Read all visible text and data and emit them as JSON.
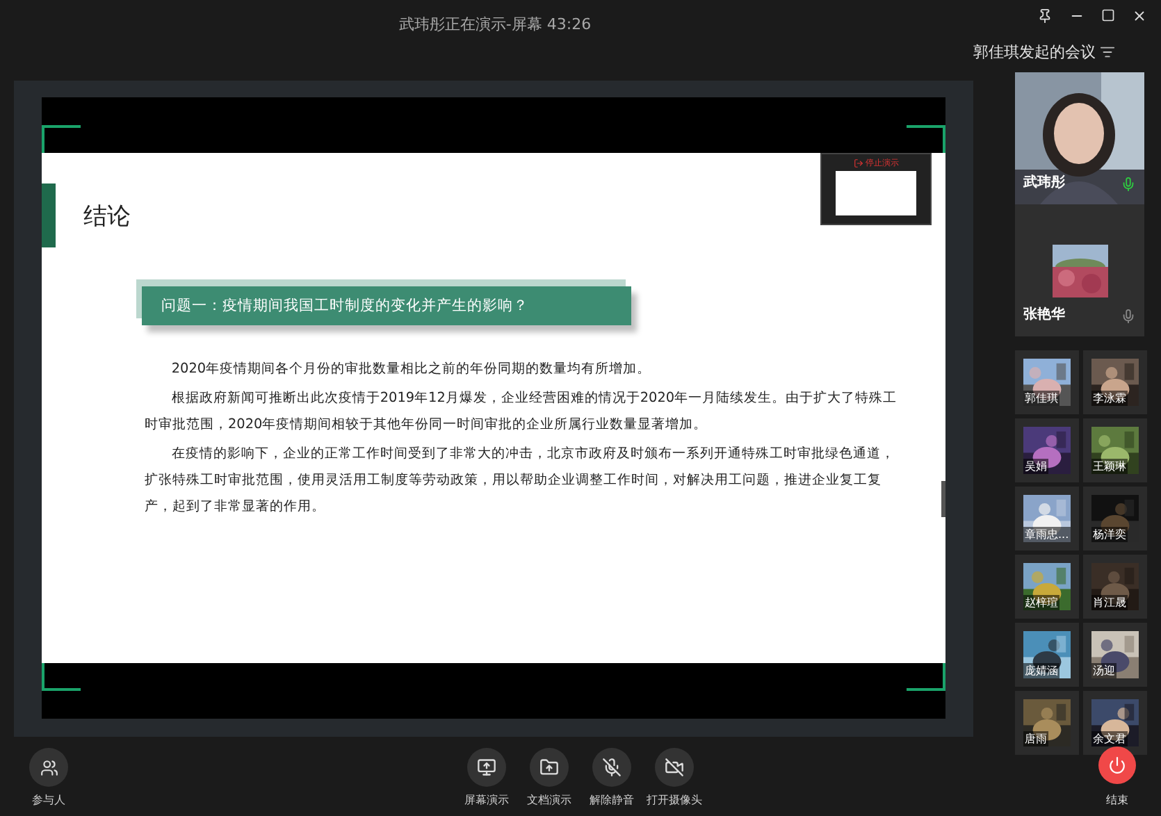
{
  "window": {
    "title": "武玮彤正在演示-屏幕 43:26"
  },
  "meeting": {
    "title": "郭佳琪发起的会议"
  },
  "slide": {
    "heading": "结论",
    "question": "问题一：疫情期间我国工时制度的变化并产生的影响？",
    "paragraphs": [
      "2020年疫情期间各个月份的审批数量相比之前的年份同期的数量均有所增加。",
      "根据政府新闻可推断出此次疫情于2019年12月爆发，企业经营困难的情况于2020年一月陆续发生。由于扩大了特殊工时审批范围，2020年疫情期间相较于其他年份同一时间审批的企业所属行业数量显著增加。",
      "在疫情的影响下，企业的正常工作时间受到了非常大的冲击，北京市政府及时颁布一系列开通特殊工时审批绿色通道，扩张特殊工时审批范围，使用灵活用工制度等劳动政策，用以帮助企业调整工作时间，对解决用工问题，推进企业复工复产，起到了非常显著的作用。"
    ]
  },
  "preview": {
    "stop_label": "停止演示"
  },
  "speakers": [
    {
      "name": "武玮彤",
      "kind": "camera",
      "speaking": true
    },
    {
      "name": "张艳华",
      "kind": "avatar",
      "speaking": false
    }
  ],
  "participants": [
    {
      "name": "郭佳琪"
    },
    {
      "name": "李泳霖"
    },
    {
      "name": "吴娟"
    },
    {
      "name": "王颖琳"
    },
    {
      "name": "章雨忠..."
    },
    {
      "name": "杨洋奕"
    },
    {
      "name": "赵梓瑄"
    },
    {
      "name": "肖江晟"
    },
    {
      "name": "庞婧涵"
    },
    {
      "name": "汤迎"
    },
    {
      "name": "唐雨"
    },
    {
      "name": "余文君"
    }
  ],
  "toolbar": {
    "participants_label": "参与人",
    "buttons": [
      {
        "label": "屏幕演示",
        "kind": "screen"
      },
      {
        "label": "文档演示",
        "kind": "document"
      },
      {
        "label": "解除静音",
        "kind": "mic"
      },
      {
        "label": "打开摄像头",
        "kind": "camera"
      }
    ],
    "end_label": "结束"
  }
}
